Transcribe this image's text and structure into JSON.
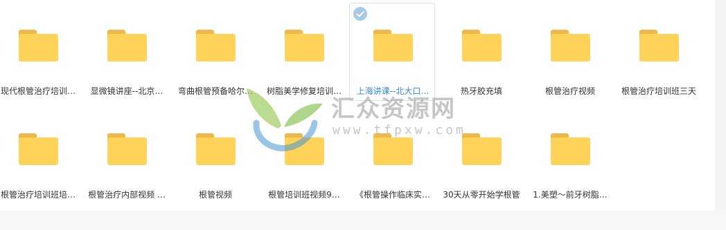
{
  "folders": [
    {
      "name": "现代根管治疗培训…",
      "selected": false
    },
    {
      "name": "显微镜讲座--北京…",
      "selected": false
    },
    {
      "name": "弯曲根管预备哈尔…",
      "selected": false
    },
    {
      "name": "树脂美学修复培训…",
      "selected": false
    },
    {
      "name": "上海讲课--北大口…",
      "selected": true
    },
    {
      "name": "热牙胶充填",
      "selected": false
    },
    {
      "name": "根管治疗视频",
      "selected": false
    },
    {
      "name": "根管治疗培训班三天",
      "selected": false
    },
    {
      "name": "根管治疗培训班培…",
      "selected": false
    },
    {
      "name": "根管治疗内部视频 …",
      "selected": false
    },
    {
      "name": "根管视频",
      "selected": false
    },
    {
      "name": "根管培训班视频9…",
      "selected": false
    },
    {
      "name": "《根管操作临床实…",
      "selected": false
    },
    {
      "name": "30天从零开始学根管",
      "selected": false
    },
    {
      "name": "1.美塑～前牙树脂…",
      "selected": false
    }
  ],
  "watermark": {
    "title": "汇众资源网",
    "url": "www.tfpxw.com"
  },
  "colors": {
    "folder_body": "#ffd25a",
    "folder_tab": "#f0b84a",
    "selected_border": "#cfe3f7",
    "selected_text": "#2f8bd6"
  }
}
